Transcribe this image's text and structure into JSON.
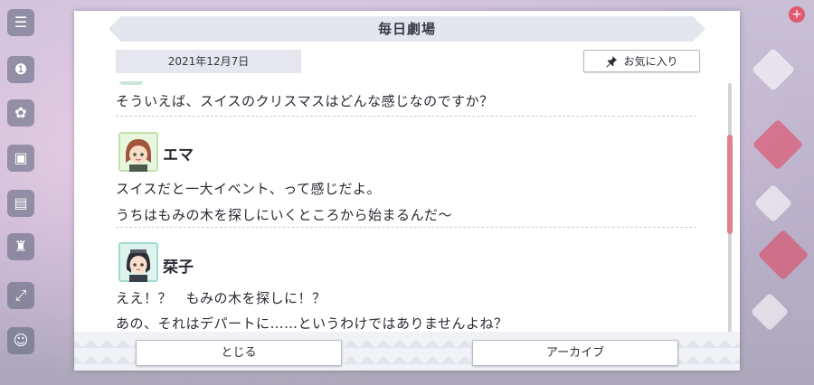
{
  "dialog": {
    "title": "毎日劇場",
    "date": "2021年12月7日",
    "favorite_label": "お気に入り",
    "close_label": "とじる",
    "archive_label": "アーカイブ"
  },
  "script": {
    "partial_line": "そういえば、スイスのクリスマスはどんな感じなのですか？",
    "blocks": [
      {
        "speaker": "エマ",
        "lines": [
          "スイスだと一大イベント、って感じだよ。",
          "うちはもみの木を探しにいくところから始まるんだ〜"
        ]
      },
      {
        "speaker": "栞子",
        "lines": [
          "ええ！？　もみの木を探しに！？",
          "あの、それはデパートに……というわけではありませんよね？"
        ]
      }
    ]
  },
  "colors": {
    "scroll_thumb": "#e4808c",
    "accent_pink": "#e35a70",
    "avatar_frame_green": "#bfe3a8",
    "avatar_frame_teal": "#9fdcd0"
  },
  "icons": {
    "favorite": "pin-icon",
    "menu": "hamburger-icon"
  }
}
